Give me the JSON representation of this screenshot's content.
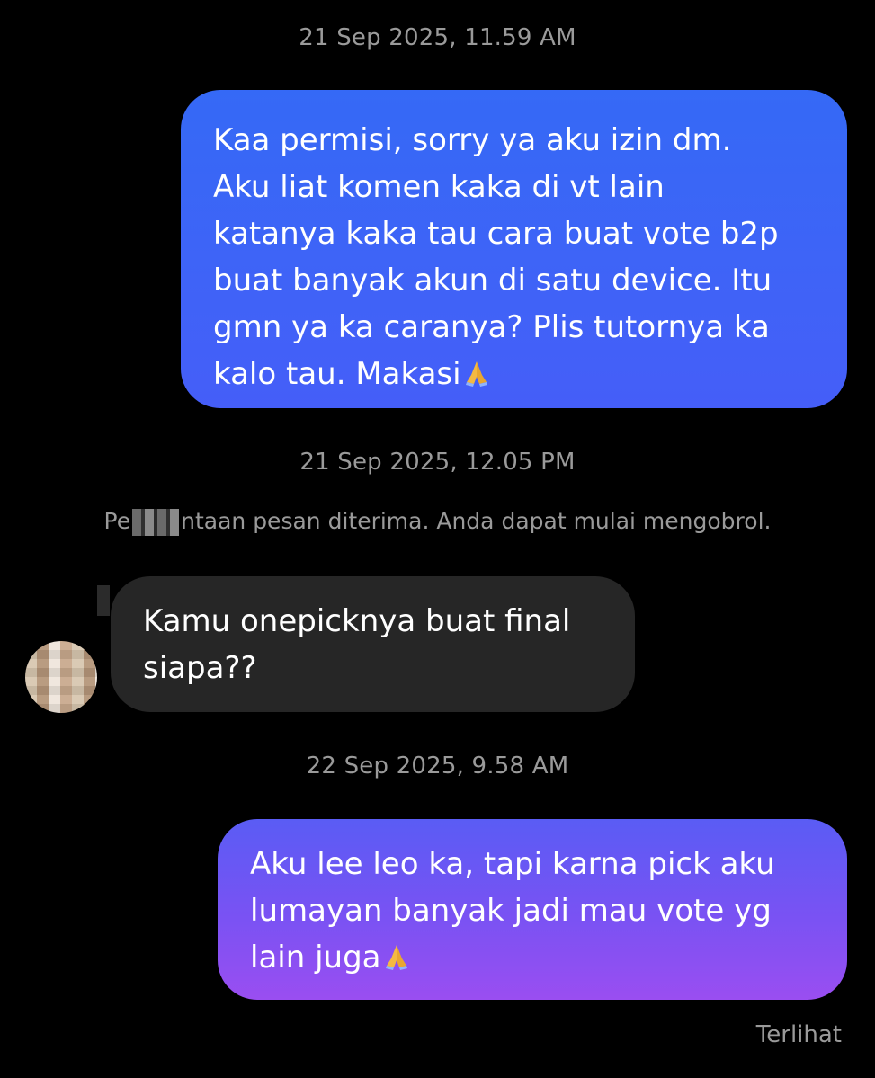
{
  "chat": {
    "timestamps": [
      "21 Sep 2025, 11.59 AM",
      "21 Sep 2025, 12.05 PM",
      "22 Sep 2025, 9.58 AM"
    ],
    "system_note_start": "Pe",
    "system_note_end": "ntaan pesan diterima. Anda dapat mulai mengobrol.",
    "messages": [
      {
        "direction": "outgoing",
        "text": "Kaa permisi, sorry ya aku izin dm.\nAku liat komen kaka di vt lain\nkatanya kaka tau cara buat vote b2p\nbuat banyak akun di satu device. Itu\ngmn ya ka caranya? Plis tutornya ka\nkalo tau. Makasi",
        "emoji": "folded-hands-icon"
      },
      {
        "direction": "incoming",
        "text": "Kamu onepicknya buat final\nsiapa??"
      },
      {
        "direction": "outgoing",
        "text": "Aku lee leo ka, tapi karna pick aku\nlumayan banyak jadi mau vote yg\nlain juga",
        "emoji": "folded-hands-icon"
      }
    ],
    "seen_label": "Terlihat"
  },
  "colors": {
    "background": "#000000",
    "timestamp_text": "#9a9a9a",
    "outgoing_bubble_blue": "#3f63f7",
    "outgoing_bubble_purple": "#8a50f2",
    "incoming_bubble": "#262626"
  }
}
